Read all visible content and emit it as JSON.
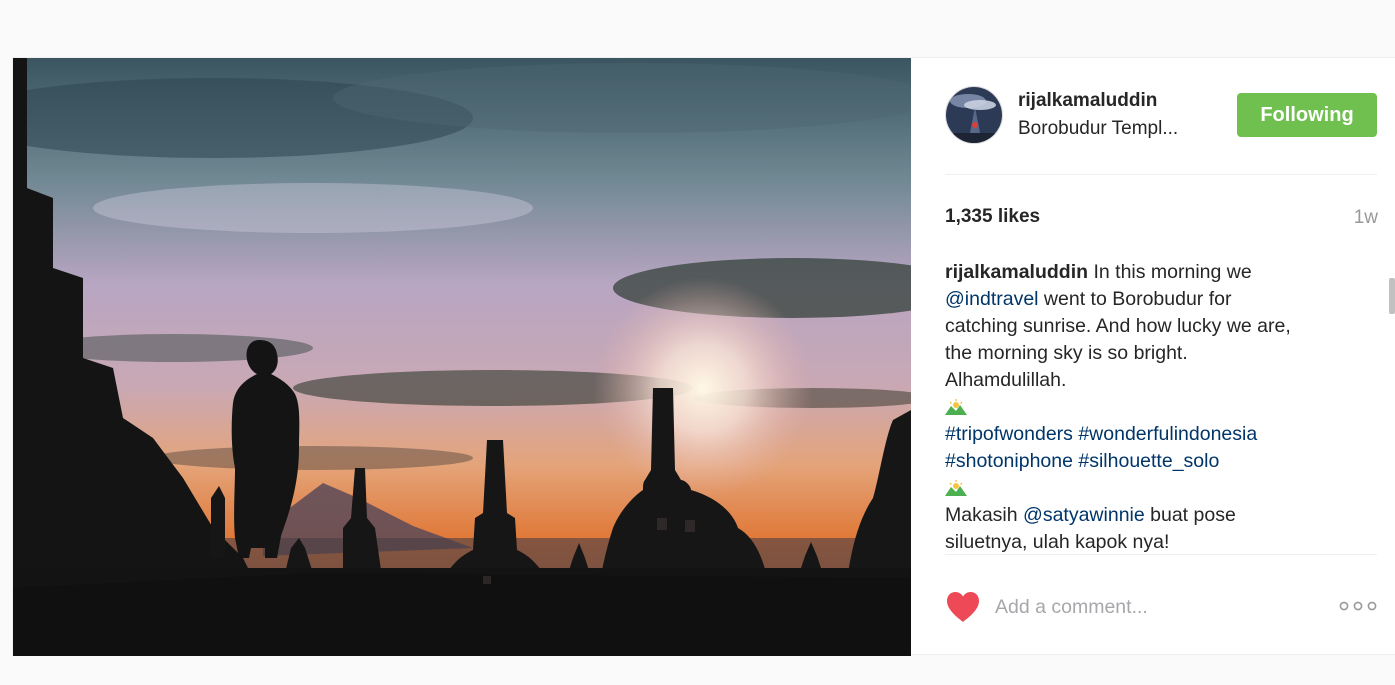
{
  "post": {
    "username": "rijalkamaluddin",
    "location": "Borobudur Templ...",
    "follow_label": "Following",
    "likes": "1,335 likes",
    "time": "1w",
    "caption": {
      "author": "rijalkamaluddin",
      "line1_rest": " In this morning we",
      "mention1": "@indtravel",
      "line2_rest": " went to Borobudur for",
      "line3": "catching sunrise. And how lucky we are,",
      "line4": "the morning sky is so bright.",
      "line5": "Alhamdulillah.",
      "tag1": "#tripofwonders",
      "tag2": "#wonderfulindonesia",
      "tag3": "#shotoniphone",
      "tag4": "#silhouette_solo",
      "line8_start": "Makasih ",
      "mention2": "@satyawinnie",
      "line8_rest": " buat pose",
      "line9": "siluetnya, ulah kapok nya!"
    },
    "comment_placeholder": "Add a comment...",
    "icons": {
      "heart": "heart-icon",
      "more": "more-options-icon",
      "sprout": "mountain-sunrise-emoji"
    },
    "colors": {
      "follow_button": "#70c050",
      "heart": "#ed4956",
      "link": "#003569"
    }
  }
}
